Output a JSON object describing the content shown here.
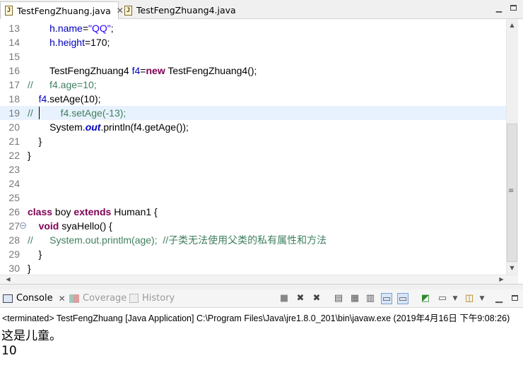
{
  "editor_tabs": [
    {
      "label": "TestFengZhuang.java",
      "active": true
    },
    {
      "label": "TestFengZhuang4.java",
      "active": false
    }
  ],
  "code_lines": [
    {
      "num": "13",
      "segs": [
        [
          "",
          "        "
        ],
        [
          "fld",
          "h"
        ],
        [
          "",
          "."
        ],
        [
          "fld",
          "name"
        ],
        [
          "",
          "="
        ],
        [
          "str",
          "\"QQ\""
        ],
        [
          "",
          ";"
        ]
      ]
    },
    {
      "num": "14",
      "segs": [
        [
          "",
          "        "
        ],
        [
          "fld",
          "h"
        ],
        [
          "",
          "."
        ],
        [
          "fld",
          "height"
        ],
        [
          "",
          "=170;"
        ]
      ]
    },
    {
      "num": "15",
      "segs": []
    },
    {
      "num": "16",
      "segs": [
        [
          "",
          "        TestFengZhuang4 "
        ],
        [
          "fld",
          "f4"
        ],
        [
          "",
          "="
        ],
        [
          "kw",
          "new"
        ],
        [
          "",
          " TestFengZhuang4();"
        ]
      ]
    },
    {
      "num": "17",
      "segs": [
        [
          "cm",
          "//      f4.age=10;"
        ]
      ]
    },
    {
      "num": "18",
      "segs": [
        [
          "",
          "    "
        ],
        [
          "fld",
          "f4"
        ],
        [
          "",
          ".setAge(10);"
        ]
      ]
    },
    {
      "num": "19",
      "segs": [
        [
          "cm",
          "//          f4.setAge(-13);"
        ]
      ],
      "current": true
    },
    {
      "num": "20",
      "segs": [
        [
          "",
          "        System."
        ],
        [
          "sfld",
          "out"
        ],
        [
          "",
          ".println(f4.getAge());"
        ]
      ]
    },
    {
      "num": "21",
      "segs": [
        [
          "",
          "    }"
        ]
      ]
    },
    {
      "num": "22",
      "segs": [
        [
          "",
          "}"
        ]
      ]
    },
    {
      "num": "23",
      "segs": []
    },
    {
      "num": "24",
      "segs": []
    },
    {
      "num": "25",
      "segs": []
    },
    {
      "num": "26",
      "segs": [
        [
          "kw",
          "class"
        ],
        [
          "",
          " boy "
        ],
        [
          "kw",
          "extends"
        ],
        [
          "",
          " Human1 {"
        ]
      ]
    },
    {
      "num": "27",
      "segs": [
        [
          "",
          "    "
        ],
        [
          "kw",
          "void"
        ],
        [
          "",
          " syaHello() {"
        ]
      ],
      "fold": "−"
    },
    {
      "num": "28",
      "segs": [
        [
          "cm",
          "//      System.out.printlm(age);  //子类无法使用父类的私有属性和方法"
        ]
      ]
    },
    {
      "num": "29",
      "segs": [
        [
          "",
          "    }"
        ]
      ]
    },
    {
      "num": "30",
      "segs": [
        [
          "",
          "}"
        ]
      ]
    }
  ],
  "console_tabs": {
    "console": "Console",
    "coverage": "Coverage",
    "history": "History"
  },
  "toolbar_icons": [
    "terminate-icon",
    "remove-launch-icon",
    "remove-all-icon",
    "clear-console-icon",
    "scroll-lock-icon",
    "word-wrap-icon",
    "show-stdout-icon",
    "show-stderr-icon",
    "pin-console-icon",
    "display-console-icon",
    "new-console-icon",
    "minimize-icon",
    "maximize-icon"
  ],
  "console": {
    "terminated_line": "<terminated> TestFengZhuang [Java Application] C:\\Program Files\\Java\\jre1.8.0_201\\bin\\javaw.exe (2019年4月16日 下午9:08:26)",
    "output": [
      "这是儿童。",
      "10"
    ]
  }
}
